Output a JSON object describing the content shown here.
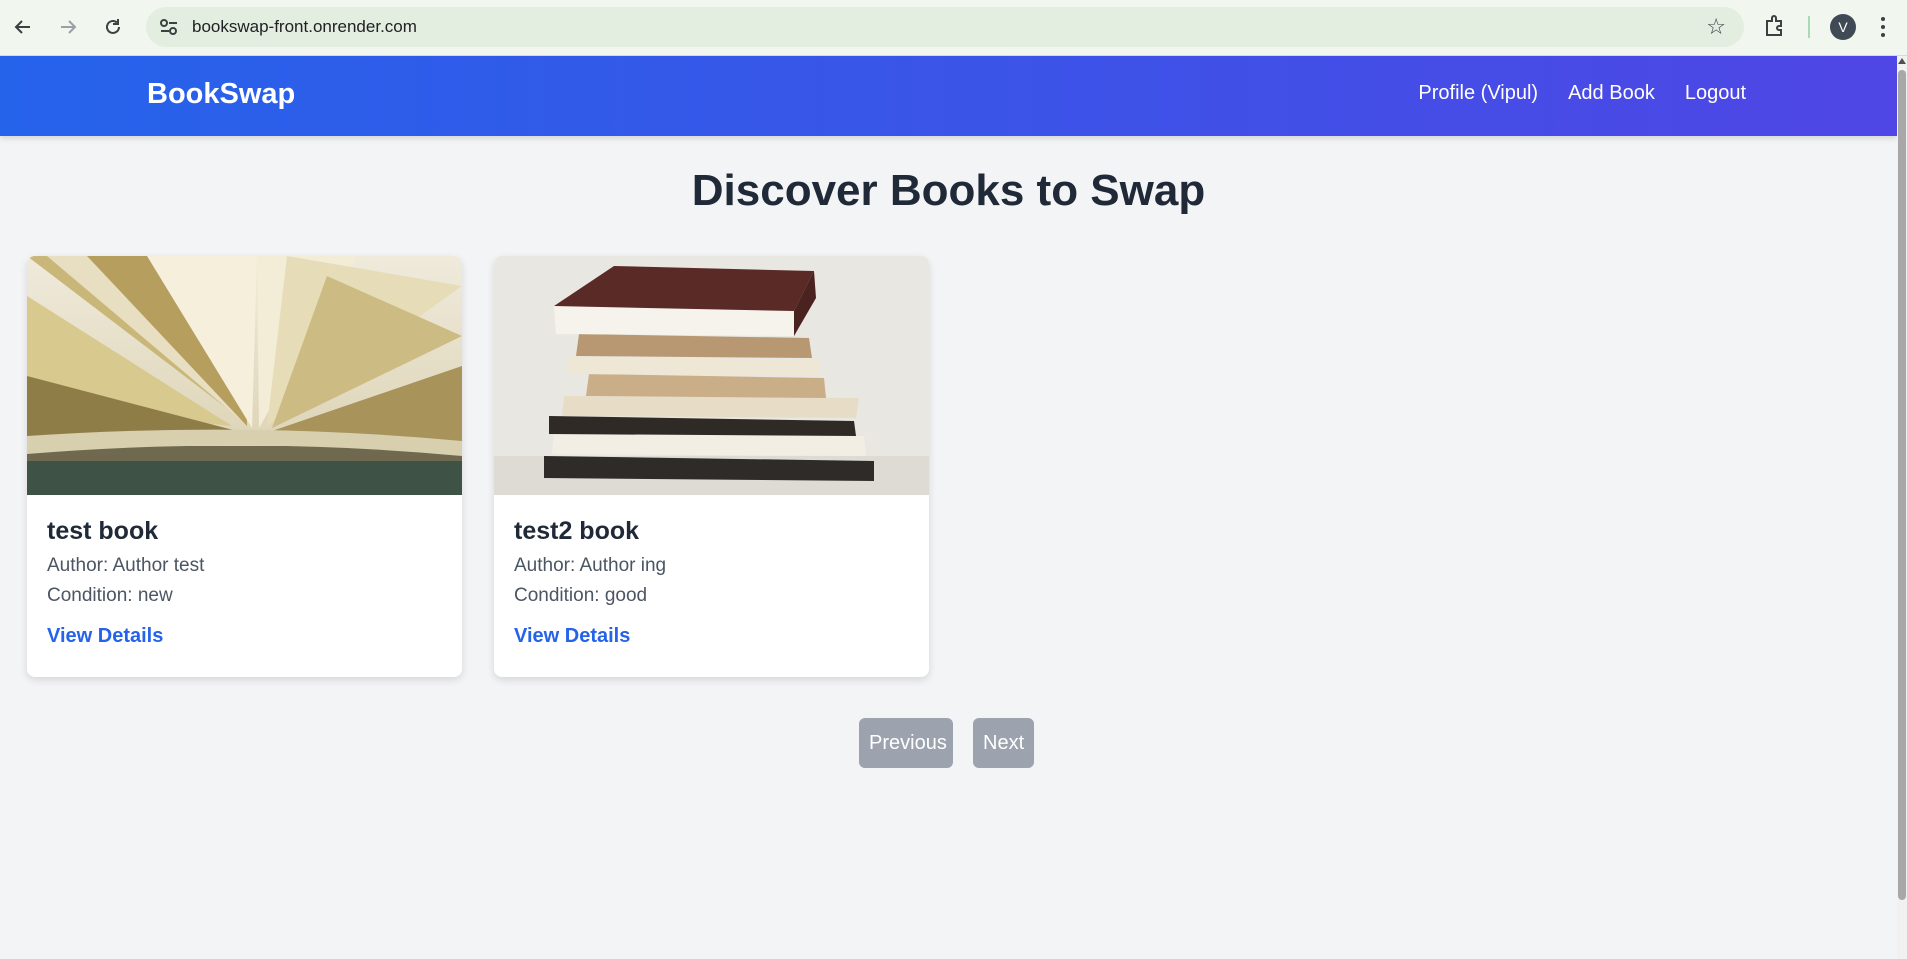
{
  "browser": {
    "url": "bookswap-front.onrender.com",
    "profile_initial": "V"
  },
  "navbar": {
    "brand": "BookSwap",
    "links": [
      "Profile (Vipul)",
      "Add Book",
      "Logout"
    ]
  },
  "page": {
    "title": "Discover Books to Swap"
  },
  "books": [
    {
      "title": "test book",
      "author": "Author: Author test",
      "condition": "Condition: new",
      "link": "View Details",
      "image": "open-book-image"
    },
    {
      "title": "test2 book",
      "author": "Author: Author ing",
      "condition": "Condition: good",
      "link": "View Details",
      "image": "book-stack-image"
    }
  ],
  "pagination": {
    "previous": "Previous",
    "next": "Next"
  },
  "colors": {
    "navbar_start": "#2563eb",
    "navbar_end": "#4f46e5",
    "link": "#2563eb",
    "disabled_button": "#9ca3af"
  }
}
